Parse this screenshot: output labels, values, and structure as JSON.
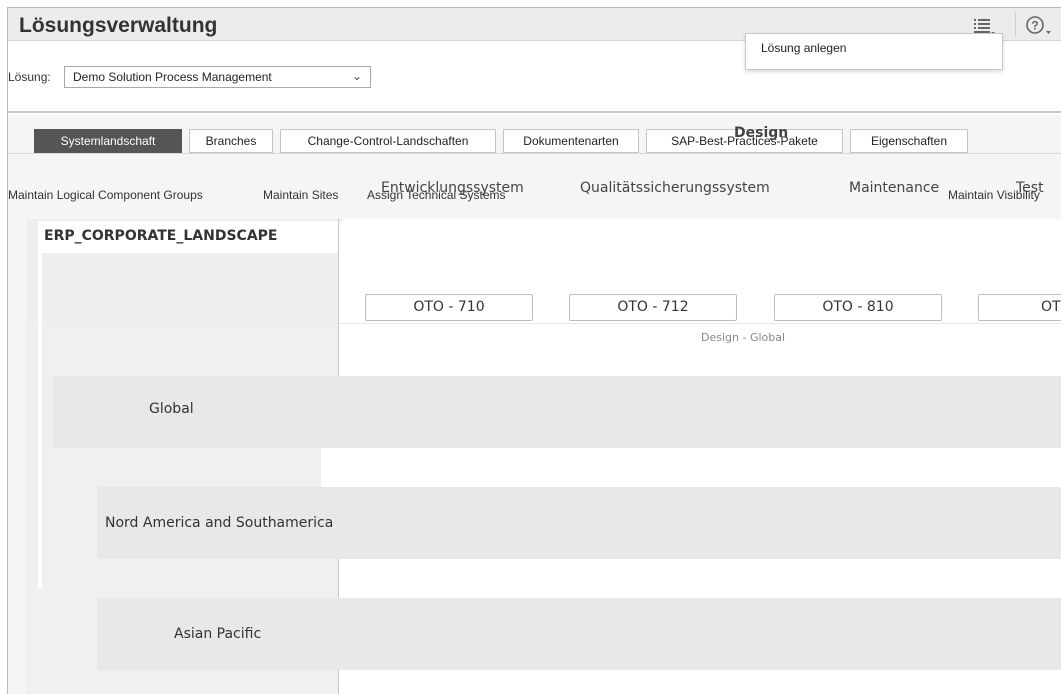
{
  "header": {
    "title": "Lösungsverwaltung",
    "icons": [
      "list-icon",
      "help-icon"
    ]
  },
  "menu": {
    "items": [
      {
        "label": "Lösung anlegen"
      }
    ]
  },
  "solution": {
    "label": "Lösung:",
    "selected": "Demo Solution Process Management"
  },
  "tabs": [
    {
      "label": "Systemlandschaft",
      "active": true
    },
    {
      "label": "Branches"
    },
    {
      "label": "Change-Control-Landschaften"
    },
    {
      "label": "Dokumentenarten"
    },
    {
      "label": "SAP-Best-Practices-Pakete"
    },
    {
      "label": "Eigenschaften"
    }
  ],
  "actions": {
    "maintain_groups": "Maintain Logical Component Groups",
    "maintain_sites": "Maintain Sites",
    "assign_systems": "Assign Technical Systems",
    "maintain_visibility": "Maintain Visibility"
  },
  "grid": {
    "phase": "Design",
    "columns": [
      "Entwicklungssystem",
      "Qualitätssicherungssystem",
      "Maintenance",
      "Test"
    ],
    "landscape": "ERP_CORPORATE_LANDSCAPE",
    "sites": [
      "Global",
      "Nord America and Southamerica",
      "Asian Pacific"
    ],
    "systems": [
      "OTO - 710",
      "OTO - 712",
      "OTO - 810",
      "OT"
    ],
    "group_label": "Design - Global"
  },
  "colors": {
    "active_tab": "#555555",
    "header_bg": "#ececec"
  }
}
